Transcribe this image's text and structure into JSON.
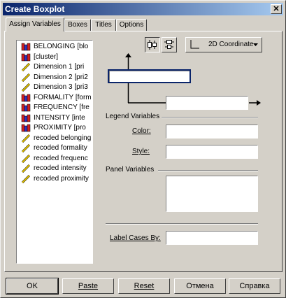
{
  "window": {
    "title": "Create Boxplot",
    "close_symbol": "✕"
  },
  "tabs": [
    {
      "label": "Assign Variables",
      "active": true
    },
    {
      "label": "Boxes",
      "active": false
    },
    {
      "label": "Titles",
      "active": false
    },
    {
      "label": "Options",
      "active": false
    }
  ],
  "variables": [
    {
      "label": "BELONGING [blo",
      "icon": "nominal-icon"
    },
    {
      "label": "[cluster]",
      "icon": "nominal-icon"
    },
    {
      "label": "Dimension 1 [pri",
      "icon": "scale-icon"
    },
    {
      "label": "Dimension 2 [pri2",
      "icon": "scale-icon"
    },
    {
      "label": "Dimension 3 [pri3",
      "icon": "scale-icon"
    },
    {
      "label": "FORMALITY [form",
      "icon": "nominal-icon"
    },
    {
      "label": "FREQUENCY [fre",
      "icon": "nominal-icon"
    },
    {
      "label": "INTENSITY [inte",
      "icon": "nominal-icon"
    },
    {
      "label": "PROXIMITY [pro",
      "icon": "nominal-icon"
    },
    {
      "label": "recoded belonging",
      "icon": "scale-icon"
    },
    {
      "label": "recoded formality",
      "icon": "scale-icon"
    },
    {
      "label": "recoded frequenc",
      "icon": "scale-icon"
    },
    {
      "label": "recoded intensity",
      "icon": "scale-icon"
    },
    {
      "label": "recoded proximity",
      "icon": "scale-icon"
    }
  ],
  "toolbar": {
    "coord_dropdown": "2D Coordinate"
  },
  "legend": {
    "group_label": "Legend Variables",
    "color_label": "Color:",
    "style_label": "Style:"
  },
  "panel": {
    "group_label": "Panel Variables"
  },
  "label_cases": {
    "label": "Label Cases By:"
  },
  "buttons": {
    "ok": "OK",
    "paste": "Paste",
    "reset": "Reset",
    "cancel": "Отмена",
    "help": "Справка"
  },
  "colors": {
    "title_start": "#0a246a",
    "title_end": "#a6caf0",
    "nominal_red": "#d02020",
    "nominal_blue": "#3030c0",
    "scale_yellow": "#e0c000",
    "selected_border": "#0a246a"
  }
}
